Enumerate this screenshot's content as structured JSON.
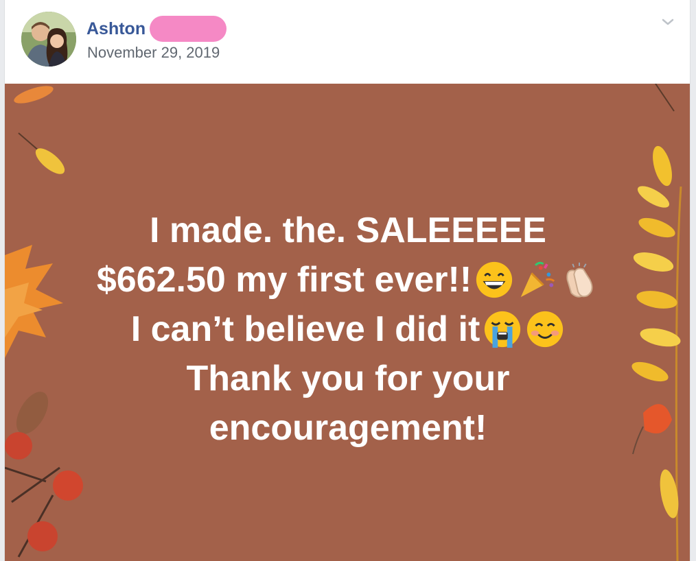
{
  "post": {
    "author": "Ashton",
    "date": "November 29, 2019",
    "message_lines": [
      "I made. the. SALEEEEE",
      "$662.50 my first ever!!",
      "I can’t believe I did it",
      "Thank you for your",
      "encouragement!"
    ]
  },
  "icons": {
    "options": "chevron-down-icon",
    "line2_emojis": [
      "grinning-face-icon",
      "party-popper-icon",
      "clapping-hands-icon"
    ],
    "line3_emojis": [
      "crying-face-icon",
      "smiling-face-icon"
    ]
  },
  "colors": {
    "card_background": "#a3614a",
    "author_link": "#385898",
    "redaction": "#f589c5",
    "message_text": "#ffffff"
  }
}
